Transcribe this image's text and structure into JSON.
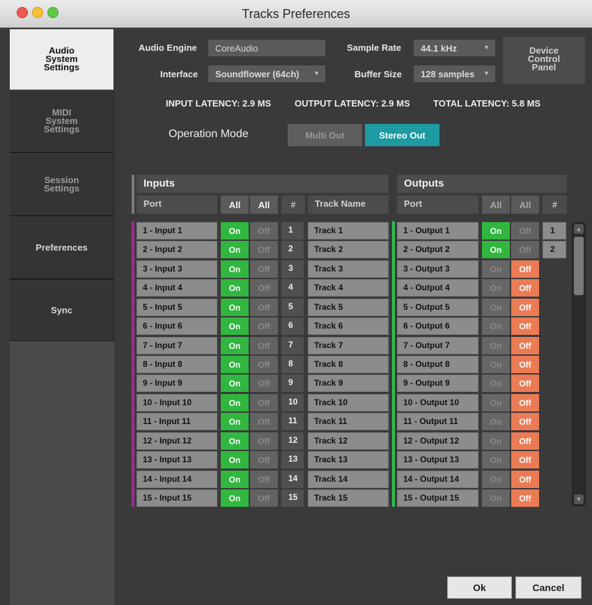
{
  "window": {
    "title": "Tracks Preferences"
  },
  "sidebar": {
    "items": [
      {
        "label": "Audio\nSystem\nSettings",
        "active": true
      },
      {
        "label": "MIDI\nSystem\nSettings",
        "active": false
      },
      {
        "label": "Session\nSettings",
        "active": false
      },
      {
        "label": "Preferences",
        "active": false
      },
      {
        "label": "Sync",
        "active": false
      }
    ]
  },
  "settings": {
    "audio_engine_label": "Audio Engine",
    "audio_engine_value": "CoreAudio",
    "interface_label": "Interface",
    "interface_value": "Soundflower (64ch)",
    "sample_rate_label": "Sample Rate",
    "sample_rate_value": "44.1 kHz",
    "buffer_size_label": "Buffer Size",
    "buffer_size_value": "128 samples",
    "device_control_panel": "Device\nControl\nPanel"
  },
  "latency": {
    "input": "INPUT LATENCY: 2.9 MS",
    "output": "OUTPUT LATENCY: 2.9 MS",
    "total": "TOTAL LATENCY: 5.8 MS"
  },
  "operation_mode": {
    "label": "Operation Mode",
    "multi_out": "Multi Out",
    "stereo_out": "Stereo Out",
    "selected": "Stereo Out"
  },
  "inputs": {
    "title": "Inputs",
    "port_header": "Port",
    "all_on": "All",
    "all_off": "All",
    "num_header": "#",
    "track_header": "Track Name",
    "rows": [
      {
        "port": "1 - Input 1",
        "on": "On",
        "off": "Off",
        "num": "1",
        "track": "Track 1"
      },
      {
        "port": "2 - Input 2",
        "on": "On",
        "off": "Off",
        "num": "2",
        "track": "Track 2"
      },
      {
        "port": "3 - Input 3",
        "on": "On",
        "off": "Off",
        "num": "3",
        "track": "Track 3"
      },
      {
        "port": "4 - Input 4",
        "on": "On",
        "off": "Off",
        "num": "4",
        "track": "Track 4"
      },
      {
        "port": "5 - Input 5",
        "on": "On",
        "off": "Off",
        "num": "5",
        "track": "Track 5"
      },
      {
        "port": "6 - Input 6",
        "on": "On",
        "off": "Off",
        "num": "6",
        "track": "Track 6"
      },
      {
        "port": "7 - Input 7",
        "on": "On",
        "off": "Off",
        "num": "7",
        "track": "Track 7"
      },
      {
        "port": "8 - Input 8",
        "on": "On",
        "off": "Off",
        "num": "8",
        "track": "Track 8"
      },
      {
        "port": "9 - Input 9",
        "on": "On",
        "off": "Off",
        "num": "9",
        "track": "Track 9"
      },
      {
        "port": "10 - Input 10",
        "on": "On",
        "off": "Off",
        "num": "10",
        "track": "Track 10"
      },
      {
        "port": "11 - Input 11",
        "on": "On",
        "off": "Off",
        "num": "11",
        "track": "Track 11"
      },
      {
        "port": "12 - Input 12",
        "on": "On",
        "off": "Off",
        "num": "12",
        "track": "Track 12"
      },
      {
        "port": "13 - Input 13",
        "on": "On",
        "off": "Off",
        "num": "13",
        "track": "Track 13"
      },
      {
        "port": "14 - Input 14",
        "on": "On",
        "off": "Off",
        "num": "14",
        "track": "Track 14"
      },
      {
        "port": "15 - Input 15",
        "on": "On",
        "off": "Off",
        "num": "15",
        "track": "Track 15"
      }
    ]
  },
  "outputs": {
    "title": "Outputs",
    "port_header": "Port",
    "all_on": "All",
    "all_off": "All",
    "num_header": "#",
    "rows": [
      {
        "port": "1 - Output 1",
        "on": "On",
        "off": "Off",
        "active": true,
        "num": "1"
      },
      {
        "port": "2 - Output 2",
        "on": "On",
        "off": "Off",
        "active": true,
        "num": "2"
      },
      {
        "port": "3 - Output 3",
        "on": "On",
        "off": "Off",
        "active": false
      },
      {
        "port": "4 - Output 4",
        "on": "On",
        "off": "Off",
        "active": false
      },
      {
        "port": "5 - Output 5",
        "on": "On",
        "off": "Off",
        "active": false
      },
      {
        "port": "6 - Output 6",
        "on": "On",
        "off": "Off",
        "active": false
      },
      {
        "port": "7 - Output 7",
        "on": "On",
        "off": "Off",
        "active": false
      },
      {
        "port": "8 - Output 8",
        "on": "On",
        "off": "Off",
        "active": false
      },
      {
        "port": "9 - Output 9",
        "on": "On",
        "off": "Off",
        "active": false
      },
      {
        "port": "10 - Output 10",
        "on": "On",
        "off": "Off",
        "active": false
      },
      {
        "port": "11 - Output 11",
        "on": "On",
        "off": "Off",
        "active": false
      },
      {
        "port": "12 - Output 12",
        "on": "On",
        "off": "Off",
        "active": false
      },
      {
        "port": "13 - Output 13",
        "on": "On",
        "off": "Off",
        "active": false
      },
      {
        "port": "14 - Output 14",
        "on": "On",
        "off": "Off",
        "active": false
      },
      {
        "port": "15 - Output 15",
        "on": "On",
        "off": "Off",
        "active": false
      }
    ]
  },
  "footer": {
    "ok": "Ok",
    "cancel": "Cancel"
  },
  "colors": {
    "on_green": "#31b640",
    "off_orange": "#ea7b55",
    "accent_teal": "#1e9aa3",
    "inputs_accent": "#9b2f8c",
    "outputs_accent": "#2fbf4f"
  }
}
